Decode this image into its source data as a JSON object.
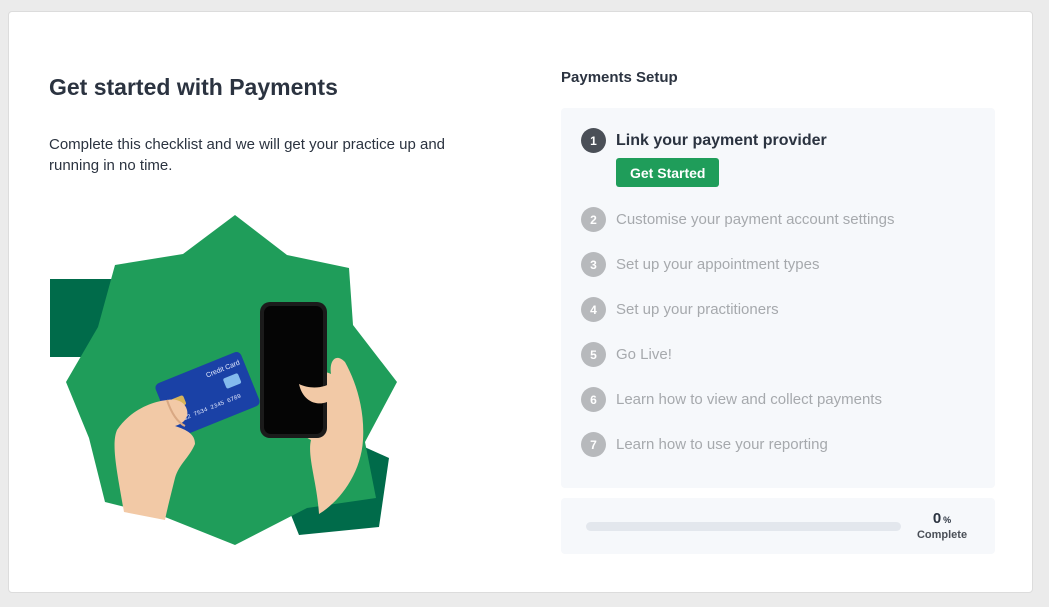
{
  "header": {
    "title": "Get started with Payments",
    "description": "Complete this checklist and we will get your practice up and running in no time."
  },
  "illustration": {
    "card_text": "Credit Card",
    "card_number": "5412 7534 2345 6789",
    "brand_color": "#1f9d5a",
    "accent_color": "#006b4a"
  },
  "setup": {
    "title": "Payments Setup",
    "steps": [
      {
        "number": "1",
        "label": "Link your payment provider",
        "active": true
      },
      {
        "number": "2",
        "label": "Customise your payment account settings"
      },
      {
        "number": "3",
        "label": "Set up your appointment types"
      },
      {
        "number": "4",
        "label": "Set up your practitioners"
      },
      {
        "number": "5",
        "label": "Go Live!"
      },
      {
        "number": "6",
        "label": "Learn how to view and collect payments"
      },
      {
        "number": "7",
        "label": "Learn how to use your reporting"
      }
    ],
    "get_started_label": "Get Started"
  },
  "progress": {
    "value": "0",
    "unit": "%",
    "caption": "Complete",
    "fraction": 0
  }
}
